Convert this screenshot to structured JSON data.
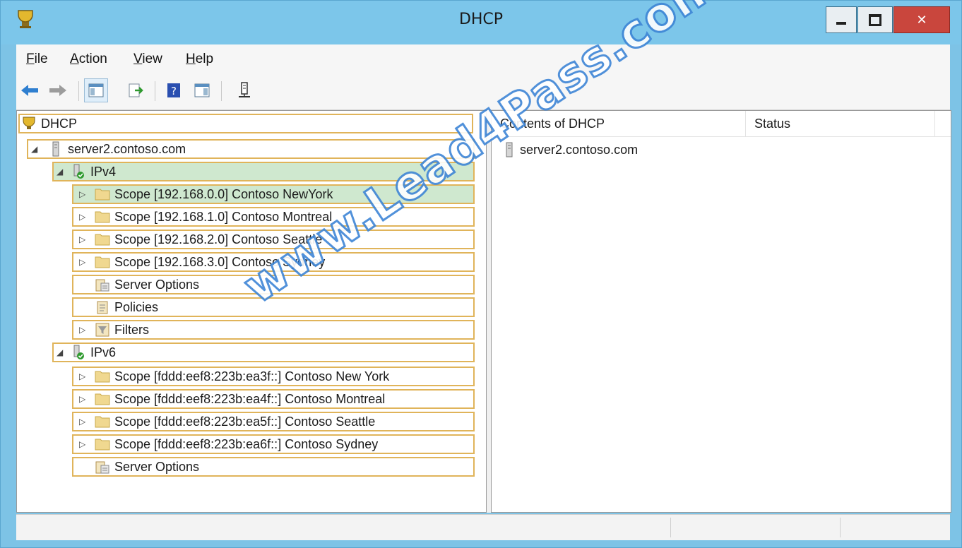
{
  "window": {
    "title": "DHCP"
  },
  "menu": [
    "File",
    "Action",
    "View",
    "Help"
  ],
  "toolbar": {
    "buttons": [
      "back-icon",
      "forward-icon",
      "show-hide-tree-icon",
      "export-list-icon",
      "help-icon",
      "action-pane-icon",
      "server-icon"
    ]
  },
  "tree": {
    "root": "DHCP",
    "server": "server2.contoso.com",
    "ipv4": {
      "label": "IPv4",
      "scopes": [
        "Scope [192.168.0.0] Contoso NewYork",
        "Scope [192.168.1.0] Contoso Montreal",
        "Scope [192.168.2.0] Contoso Seattle",
        "Scope [192.168.3.0] Contoso Sydney"
      ],
      "server_options": "Server Options",
      "policies": "Policies",
      "filters": "Filters"
    },
    "ipv6": {
      "label": "IPv6",
      "scopes": [
        "Scope [fddd:eef8:223b:ea3f::] Contoso New York",
        "Scope [fddd:eef8:223b:ea4f::] Contoso Montreal",
        "Scope [fddd:eef8:223b:ea5f::] Contoso Seattle",
        "Scope [fddd:eef8:223b:ea6f::] Contoso Sydney"
      ],
      "server_options": "Server Options"
    }
  },
  "list": {
    "columns": [
      "Contents of DHCP",
      "Status"
    ],
    "rows": [
      {
        "name": "server2.contoso.com",
        "status": ""
      }
    ]
  },
  "watermark": "www.Lead4Pass.com",
  "colors": {
    "titlebar": "#7cc6ea",
    "selected_row": "#cfe8cf",
    "row_border": "#e0b45a",
    "close_button": "#c9463d"
  }
}
